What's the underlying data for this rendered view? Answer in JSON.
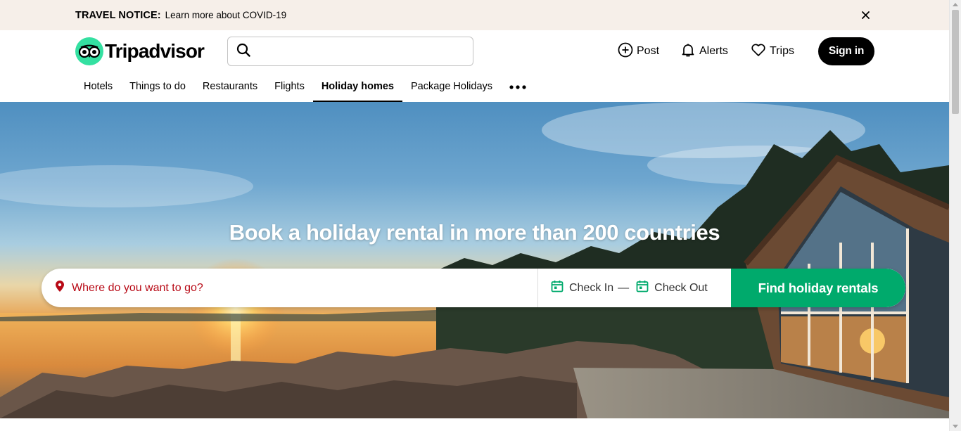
{
  "notice": {
    "label": "TRAVEL NOTICE:",
    "link": "Learn more about COVID-19",
    "close_icon": "close-icon"
  },
  "header": {
    "logo_text": "Tripadvisor",
    "search_placeholder": "",
    "actions": {
      "post": "Post",
      "alerts": "Alerts",
      "trips": "Trips"
    },
    "sign_in": "Sign in"
  },
  "nav": {
    "items": [
      "Hotels",
      "Things to do",
      "Restaurants",
      "Flights",
      "Holiday homes",
      "Package Holidays"
    ],
    "active": "Holiday homes",
    "more_icon": "more-dots-icon"
  },
  "hero": {
    "title": "Book a holiday rental in more than 200 countries",
    "where_placeholder": "Where do you want to go?",
    "check_in": "Check In",
    "separator": "—",
    "check_out": "Check Out",
    "find_button": "Find holiday rentals"
  },
  "colors": {
    "notice_bg": "#f6efe9",
    "brand_green": "#34e0a1",
    "cta_green": "#00aa6c",
    "pin_red": "#b80a16",
    "signin_bg": "#000000"
  }
}
